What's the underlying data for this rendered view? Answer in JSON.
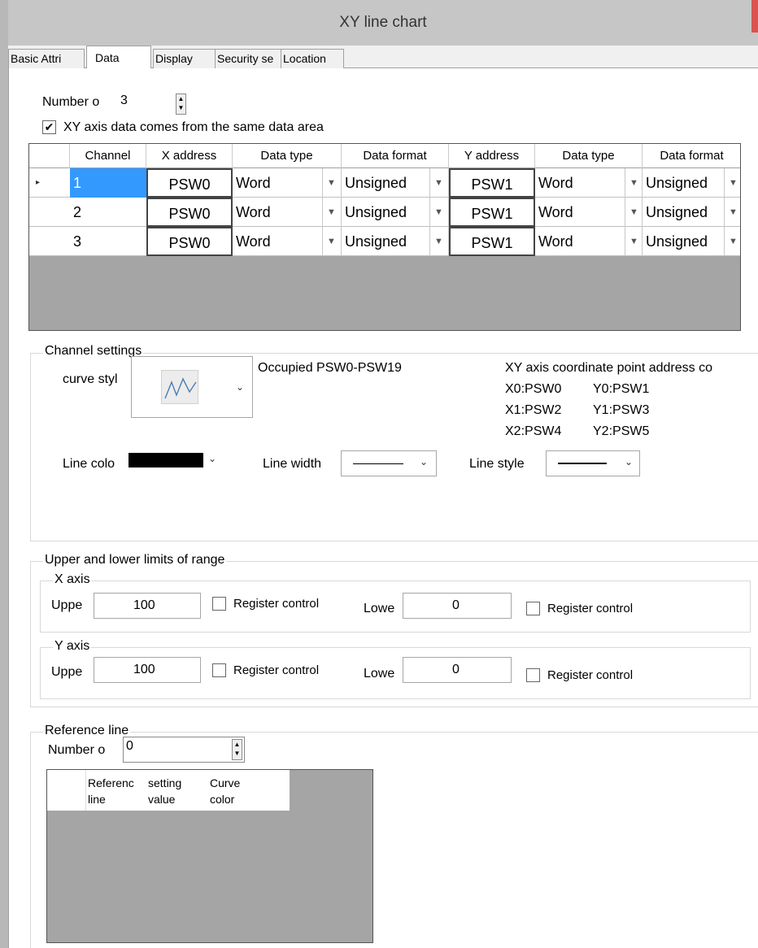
{
  "window": {
    "title": "XY line chart"
  },
  "tabs": [
    {
      "label": "Basic Attri"
    },
    {
      "label": "Data"
    },
    {
      "label": "Display"
    },
    {
      "label": "Security se"
    },
    {
      "label": "Location"
    }
  ],
  "data_tab": {
    "number_label": "Number o",
    "number_value": "3",
    "same_area_label": "XY axis data comes from the same data area",
    "same_area_checked": true,
    "table": {
      "headers": [
        "Channel",
        "X address",
        "Data type",
        "Data format",
        "Y address",
        "Data type",
        "Data format"
      ],
      "rows": [
        {
          "indicator": "▸",
          "channel": "1",
          "x_address": "PSW0",
          "x_type": "Word",
          "x_format": "Unsigned",
          "y_address": "PSW1",
          "y_type": "Word",
          "y_format": "Unsigned"
        },
        {
          "indicator": "",
          "channel": "2",
          "x_address": "PSW0",
          "x_type": "Word",
          "x_format": "Unsigned",
          "y_address": "PSW1",
          "y_type": "Word",
          "y_format": "Unsigned"
        },
        {
          "indicator": "",
          "channel": "3",
          "x_address": "PSW0",
          "x_type": "Word",
          "x_format": "Unsigned",
          "y_address": "PSW1",
          "y_type": "Word",
          "y_format": "Unsigned"
        }
      ]
    },
    "channel_settings": {
      "title": "Channel settings",
      "curve_style_label": "curve styl",
      "occupied": "Occupied PSW0-PSW19",
      "coord_title": "XY axis coordinate point address co",
      "coords": [
        {
          "x": "X0:PSW0",
          "y": "Y0:PSW1"
        },
        {
          "x": "X1:PSW2",
          "y": "Y1:PSW3"
        },
        {
          "x": "X2:PSW4",
          "y": "Y2:PSW5"
        }
      ],
      "line_color_label": "Line colo",
      "line_color": "#000000",
      "line_width_label": "Line width",
      "line_style_label": "Line style"
    },
    "limits": {
      "title": "Upper and lower limits of range",
      "x_axis": {
        "title": "X axis",
        "upper_label": "Uppe",
        "upper_value": "100",
        "register_label": "Register control",
        "lower_label": "Lowe",
        "lower_value": "0"
      },
      "y_axis": {
        "title": "Y axis",
        "upper_label": "Uppe",
        "upper_value": "100",
        "register_label": "Register control",
        "lower_label": "Lowe",
        "lower_value": "0"
      }
    },
    "reference_line": {
      "title": "Reference line",
      "number_label": "Number o",
      "number_value": "0",
      "headers": [
        "Referenc line",
        "setting value",
        "Curve color"
      ]
    }
  },
  "colors": {
    "accent": "#3399ff",
    "grid_bg": "#a5a5a5",
    "selected_text": "#ffffff"
  },
  "icons": {
    "curve_style": "line-graph-icon",
    "dropdown": "chevron-down-icon",
    "spinner": "spinner-arrows-icon"
  }
}
